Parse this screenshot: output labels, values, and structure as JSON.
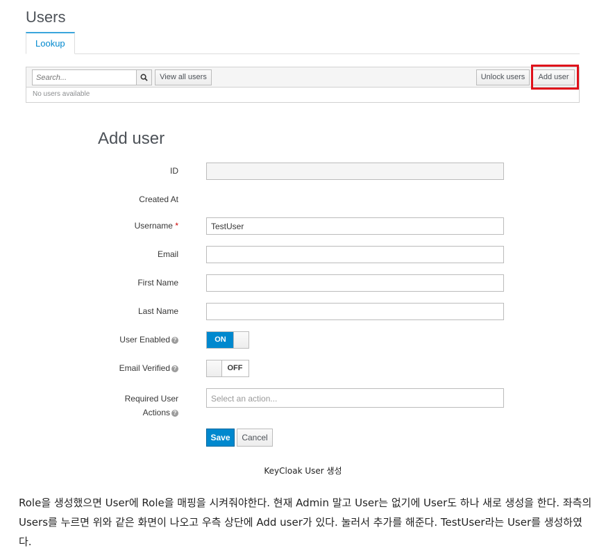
{
  "page": {
    "title": "Users"
  },
  "tabs": [
    {
      "label": "Lookup",
      "active": true
    }
  ],
  "toolbar": {
    "search_placeholder": "Search...",
    "view_all_label": "View all users",
    "unlock_label": "Unlock users",
    "add_user_label": "Add user"
  },
  "table": {
    "empty_text": "No users available"
  },
  "form": {
    "title": "Add user",
    "fields": {
      "id": {
        "label": "ID",
        "value": ""
      },
      "created_at": {
        "label": "Created At"
      },
      "username": {
        "label": "Username",
        "required_mark": "*",
        "value": "TestUser"
      },
      "email": {
        "label": "Email",
        "value": ""
      },
      "first_name": {
        "label": "First Name",
        "value": ""
      },
      "last_name": {
        "label": "Last Name",
        "value": ""
      },
      "user_enabled": {
        "label": "User Enabled",
        "state_label": "ON"
      },
      "email_verified": {
        "label": "Email Verified",
        "state_label": "OFF"
      },
      "required_actions": {
        "label_line1": "Required User",
        "label_line2": "Actions",
        "placeholder": "Select an action..."
      }
    },
    "save_label": "Save",
    "cancel_label": "Cancel"
  },
  "caption": "KeyCloak User 생성",
  "paragraph": "Role을 생성했으면 User에 Role을 매핑을 시켜줘야한다. 현재 Admin 말고 User는 없기에 User도 하나 새로 생성을 한다. 좌측의 Users를 누르면 위와 같은 화면이 나오고 우측 상단에 Add user가 있다. 눌러서 추가를 해준다. TestUser라는 User를 생성하였다.",
  "colors": {
    "accent": "#0088ce",
    "highlight": "#e0101a",
    "tab_border": "#39a5dc"
  }
}
